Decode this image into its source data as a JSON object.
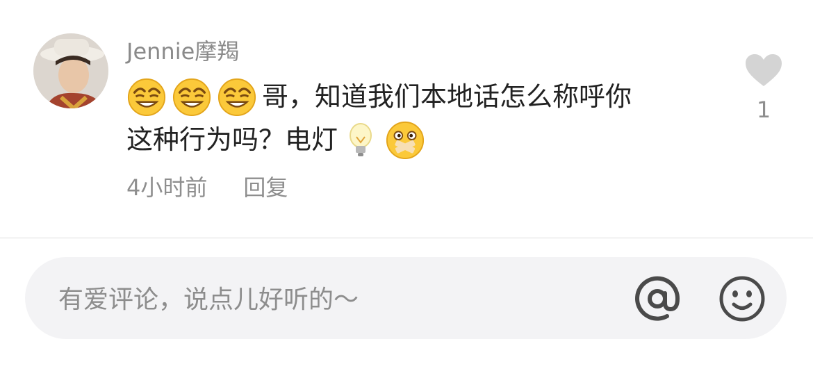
{
  "comment": {
    "username": "Jennie摩羯",
    "text_line1": "哥，知道我们本地话怎么称呼你",
    "text_line2_a": "这种行为吗？电灯",
    "line1_emojis": [
      "smirk-face-icon",
      "smirk-face-icon",
      "smirk-face-icon"
    ],
    "line2_emojis": [
      "light-bulb-icon",
      "mouth-taped-face-icon"
    ],
    "time": "4小时前",
    "reply_label": "回复",
    "like_count": "1"
  },
  "composer": {
    "placeholder": "有爱评论，说点儿好听的～",
    "mention_icon": "at-icon",
    "emoji_icon": "smile-face-icon"
  },
  "colors": {
    "muted_text": "#8e8e8e",
    "body_text": "#222222",
    "input_bg": "#f3f3f5",
    "emoji_yellow": "#fbc93a"
  }
}
